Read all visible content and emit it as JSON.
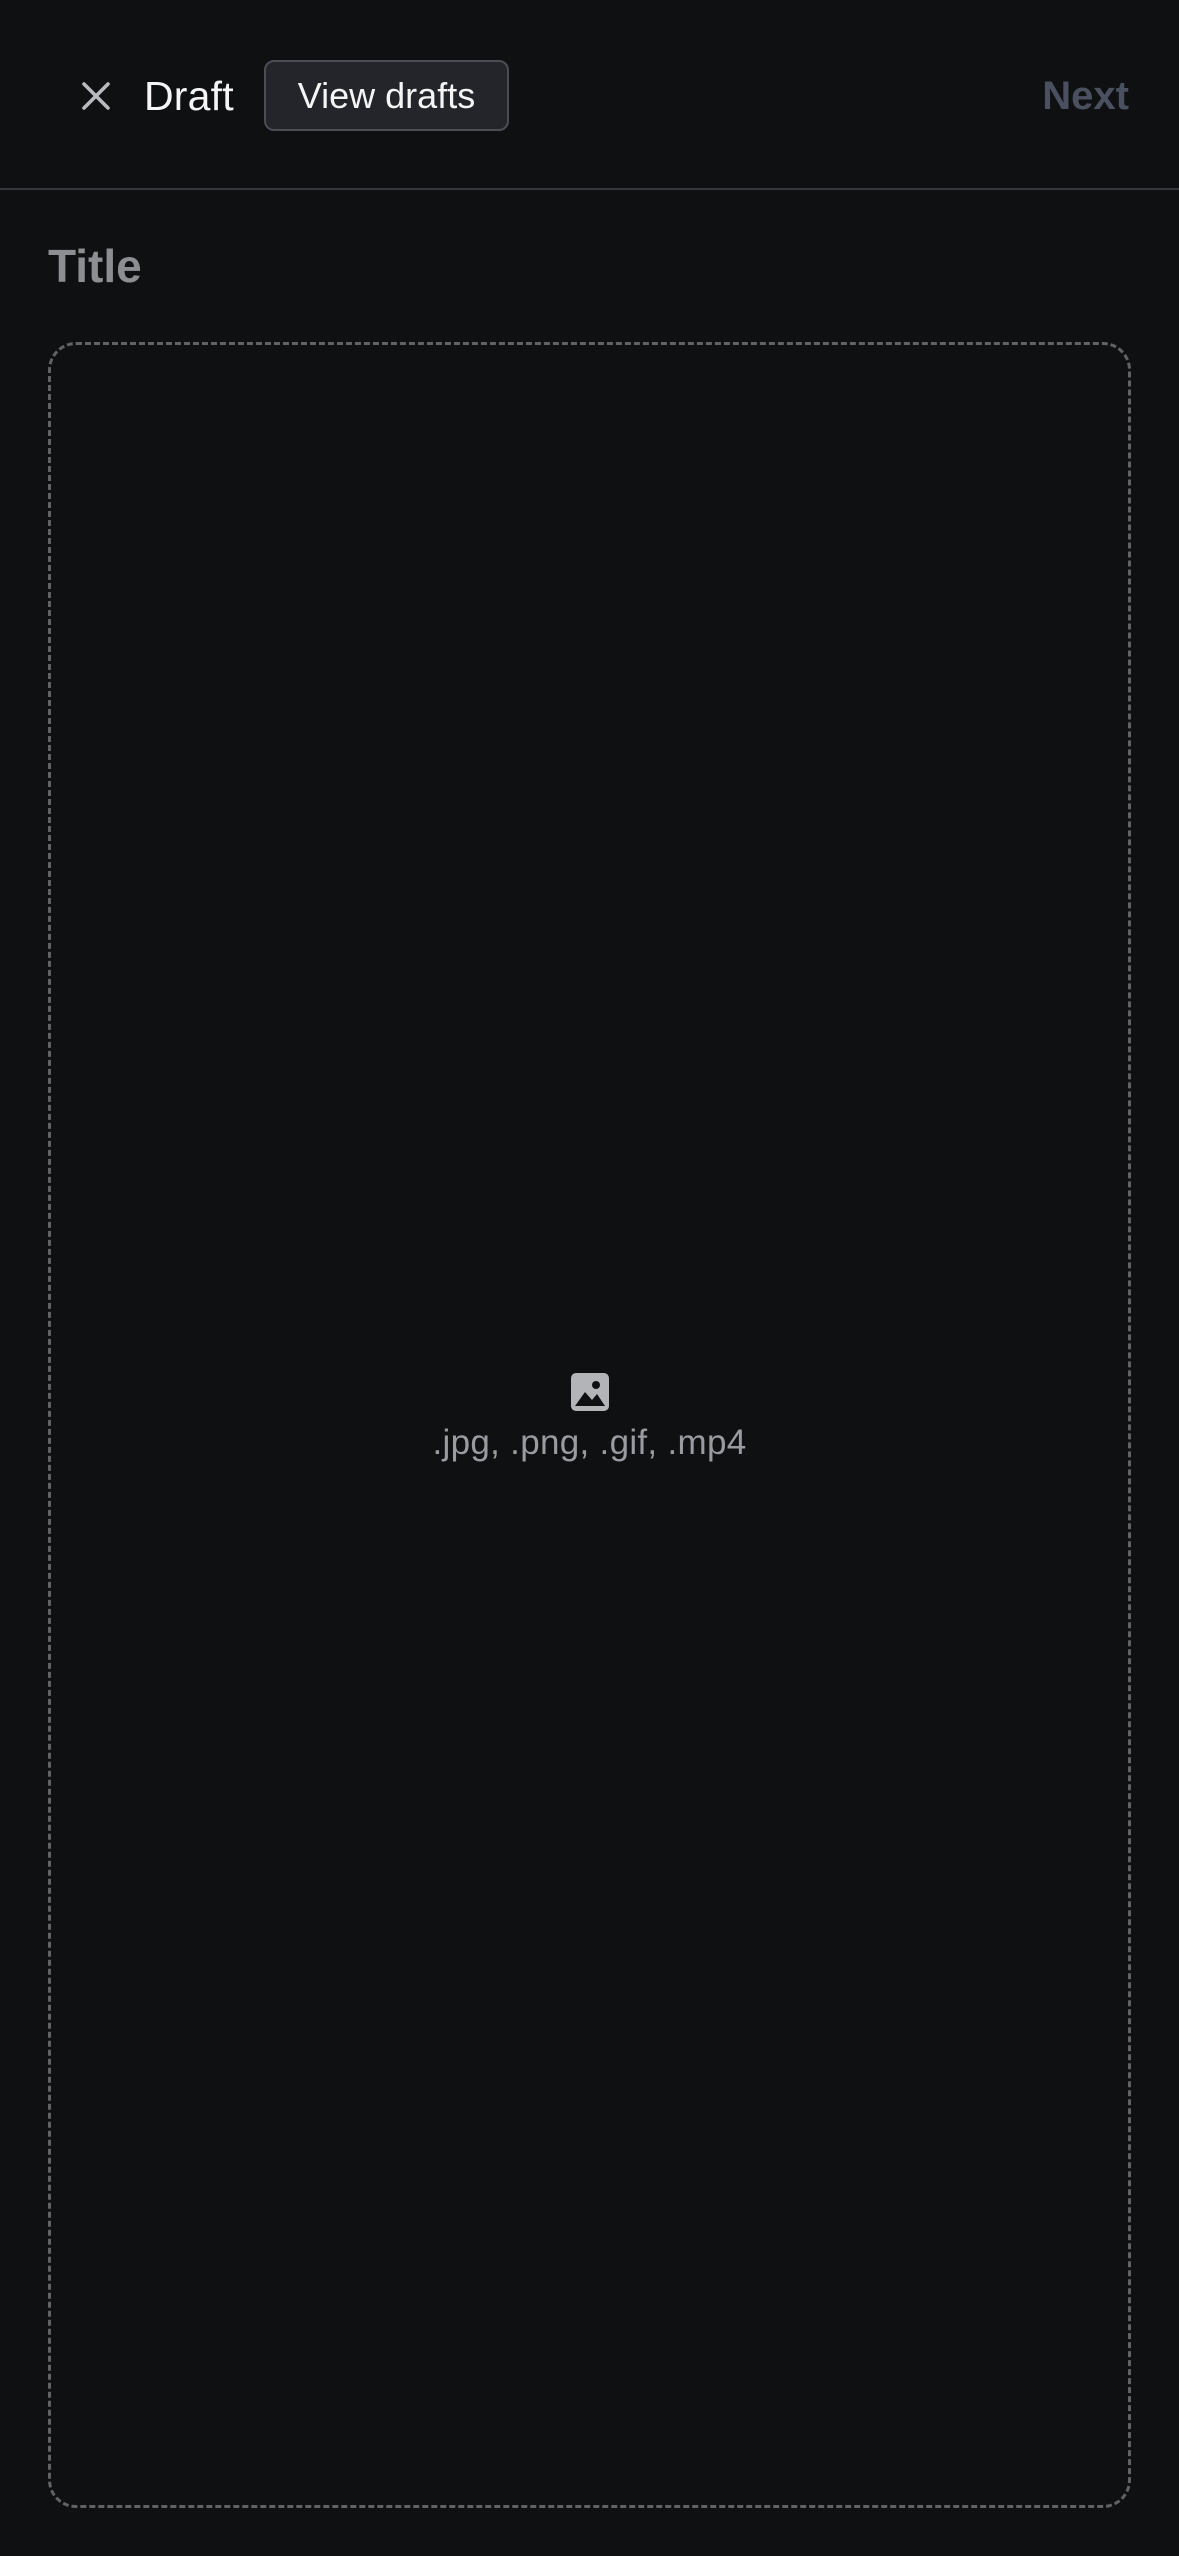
{
  "header": {
    "close_icon": "close-icon",
    "title": "Draft",
    "view_drafts_label": "View drafts",
    "next_label": "Next"
  },
  "title_field": {
    "placeholder": "Title"
  },
  "upload": {
    "icon": "image-icon",
    "formats_text": ".jpg, .png, .gif, .mp4"
  },
  "colors": {
    "background": "#0f1012",
    "next_disabled": "#4b5060",
    "button_bg": "#23252b"
  }
}
